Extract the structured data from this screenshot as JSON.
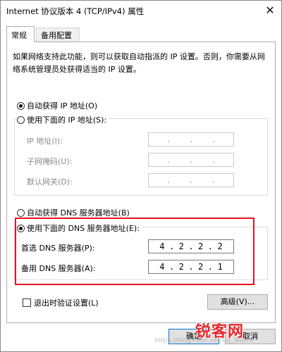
{
  "window": {
    "title": "Internet 协议版本 4 (TCP/IPv4) 属性",
    "close_glyph": "✕"
  },
  "tabs": [
    {
      "label": "常规",
      "active": true
    },
    {
      "label": "备用配置",
      "active": false
    }
  ],
  "description": "如果网络支持此功能，则可以获取自动指派的 IP 设置。否则，你需要从网络系统管理员处获得适当的 IP 设置。",
  "ip": {
    "auto_label": "自动获得 IP 地址(O)",
    "auto_checked": true,
    "manual_label": "使用下面的 IP 地址(S):",
    "manual_checked": false,
    "fields": [
      {
        "label": "IP 地址(I):",
        "value": [
          ".",
          ".",
          "."
        ]
      },
      {
        "label": "子网掩码(U):",
        "value": [
          ".",
          ".",
          "."
        ]
      },
      {
        "label": "默认网关(D):",
        "value": [
          ".",
          ".",
          "."
        ]
      }
    ]
  },
  "dns": {
    "auto_label": "自动获得 DNS 服务器地址(B)",
    "auto_checked": false,
    "manual_label": "使用下面的 DNS 服务器地址(E):",
    "manual_checked": true,
    "preferred_label": "首选 DNS 服务器(P):",
    "preferred_octets": [
      "4",
      ".",
      "2",
      ".",
      "2",
      ".",
      "2"
    ],
    "alternate_label": "备用 DNS 服务器(A):",
    "alternate_octets": [
      "4",
      ".",
      "2",
      ".",
      "2",
      ".",
      "1"
    ]
  },
  "validate_label": "退出时验证设置(L)",
  "validate_checked": false,
  "advanced_button": "高级(V)...",
  "ok_button": "确定",
  "cancel_button": "取消",
  "watermark": {
    "logo": "锐客网",
    "url": "https://blog.csdn.net/qq_36078"
  },
  "colors": {
    "highlight": "#e81123",
    "accent": "#0078d7"
  }
}
